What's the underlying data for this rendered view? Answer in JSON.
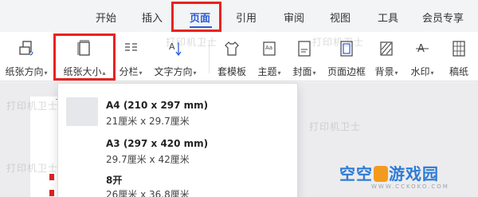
{
  "tabs": [
    {
      "label": "开始"
    },
    {
      "label": "插入"
    },
    {
      "label": "页面"
    },
    {
      "label": "引用"
    },
    {
      "label": "审阅"
    },
    {
      "label": "视图"
    },
    {
      "label": "工具"
    },
    {
      "label": "会员专享"
    }
  ],
  "active_tab": "页面",
  "ribbon": {
    "orientation": "纸张方向",
    "paper_size": "纸张大小",
    "columns": "分栏",
    "text_direction": "文字方向",
    "template": "套模板",
    "theme": "主题",
    "cover": "封面",
    "page_border": "页面边框",
    "background": "背景",
    "watermark": "水印",
    "draft_paper": "稿纸"
  },
  "dropdown": {
    "items": [
      {
        "name": "A4 (210 x 297 mm)",
        "dims": "21厘米  x  29.7厘米"
      },
      {
        "name": "A3 (297 x 420 mm)",
        "dims": "29.7厘米  x  42厘米"
      },
      {
        "name": "8开",
        "dims": "26厘米  x  36.8厘米"
      }
    ]
  },
  "watermarks": [
    "打印机卫士",
    "打印机卫士",
    "打印机卫士",
    "打印机卫士",
    "打印机卫士"
  ],
  "logo": {
    "text_left": "空空",
    "text_right": "游戏园",
    "sub": "WWW.CCKOKO.COM"
  },
  "colors": {
    "accent": "#2a5bd7",
    "highlight": "#e8231f",
    "logo": "#2e7bd6"
  }
}
